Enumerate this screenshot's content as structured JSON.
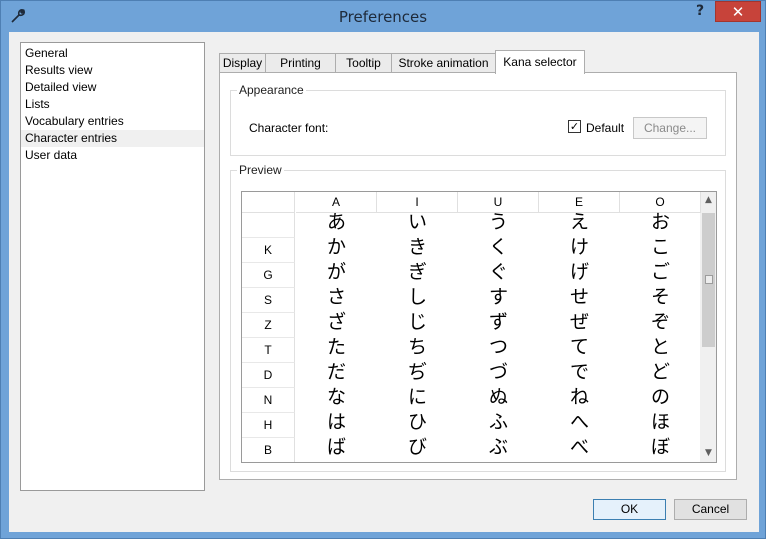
{
  "window": {
    "title": "Preferences",
    "help_label": "?",
    "close_label": "✕"
  },
  "nav": {
    "items": [
      {
        "label": "General"
      },
      {
        "label": "Results view"
      },
      {
        "label": "Detailed view"
      },
      {
        "label": "Lists"
      },
      {
        "label": "Vocabulary entries"
      },
      {
        "label": "Character entries",
        "selected": true
      },
      {
        "label": "User data"
      }
    ]
  },
  "tabs": [
    {
      "label": "Display"
    },
    {
      "label": "Printing"
    },
    {
      "label": "Tooltip"
    },
    {
      "label": "Stroke animation"
    },
    {
      "label": "Kana selector",
      "active": true
    }
  ],
  "appearance": {
    "title": "Appearance",
    "font_label": "Character font:",
    "default_label": "Default",
    "default_checked": true,
    "change_label": "Change..."
  },
  "preview": {
    "title": "Preview",
    "columns": [
      "A",
      "I",
      "U",
      "E",
      "O"
    ],
    "rows": [
      {
        "label": "",
        "kana": [
          "あ",
          "い",
          "う",
          "え",
          "お"
        ]
      },
      {
        "label": "K",
        "kana": [
          "か",
          "き",
          "く",
          "け",
          "こ"
        ]
      },
      {
        "label": "G",
        "kana": [
          "が",
          "ぎ",
          "ぐ",
          "げ",
          "ご"
        ]
      },
      {
        "label": "S",
        "kana": [
          "さ",
          "し",
          "す",
          "せ",
          "そ"
        ]
      },
      {
        "label": "Z",
        "kana": [
          "ざ",
          "じ",
          "ず",
          "ぜ",
          "ぞ"
        ]
      },
      {
        "label": "T",
        "kana": [
          "た",
          "ち",
          "つ",
          "て",
          "と"
        ]
      },
      {
        "label": "D",
        "kana": [
          "だ",
          "ぢ",
          "づ",
          "で",
          "ど"
        ]
      },
      {
        "label": "N",
        "kana": [
          "な",
          "に",
          "ぬ",
          "ね",
          "の"
        ]
      },
      {
        "label": "H",
        "kana": [
          "は",
          "ひ",
          "ふ",
          "へ",
          "ほ"
        ]
      },
      {
        "label": "B",
        "kana": [
          "ば",
          "び",
          "ぶ",
          "べ",
          "ぼ"
        ]
      }
    ]
  },
  "buttons": {
    "ok_label": "OK",
    "cancel_label": "Cancel"
  },
  "colors": {
    "titlebar": "#6fa3d8",
    "close": "#c7433a"
  }
}
